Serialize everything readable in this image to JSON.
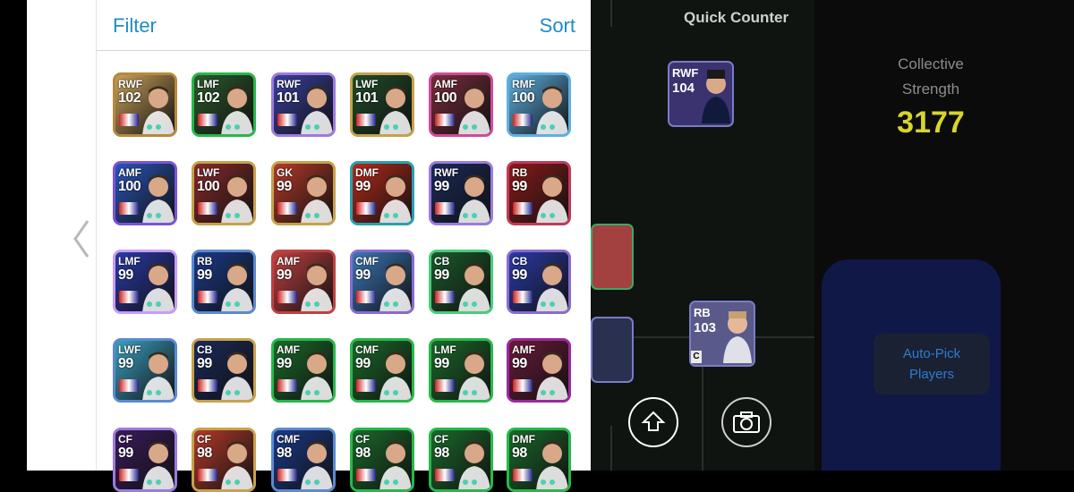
{
  "panel": {
    "filter_label": "Filter",
    "sort_label": "Sort"
  },
  "cards": [
    {
      "pos": "RWF",
      "ovr": "102",
      "bg": "#c9a05a",
      "border": "#b58a3c"
    },
    {
      "pos": "LMF",
      "ovr": "102",
      "bg": "#2c5a2c",
      "border": "#27b84b"
    },
    {
      "pos": "RWF",
      "ovr": "101",
      "bg": "#3a3f9e",
      "border": "#9b7be0"
    },
    {
      "pos": "LWF",
      "ovr": "101",
      "bg": "#1f4d2a",
      "border": "#c6a24b"
    },
    {
      "pos": "AMF",
      "ovr": "100",
      "bg": "#7a2c3c",
      "border": "#d04a9a"
    },
    {
      "pos": "RMF",
      "ovr": "100",
      "bg": "#5fb0e0",
      "border": "#5fb0e0"
    },
    {
      "pos": "AMF",
      "ovr": "100",
      "bg": "#2a55b8",
      "border": "#7b54d8"
    },
    {
      "pos": "LWF",
      "ovr": "100",
      "bg": "#8a2a2a",
      "border": "#c6a24b"
    },
    {
      "pos": "GK",
      "ovr": "99",
      "bg": "#b43a2a",
      "border": "#c6a24b"
    },
    {
      "pos": "DMF",
      "ovr": "99",
      "bg": "#b32a1a",
      "border": "#2aa0b0"
    },
    {
      "pos": "RWF",
      "ovr": "99",
      "bg": "#1a2a5a",
      "border": "#9b7be0"
    },
    {
      "pos": "RB",
      "ovr": "99",
      "bg": "#8a1a1a",
      "border": "#c13a5a"
    },
    {
      "pos": "LMF",
      "ovr": "99",
      "bg": "#2a3aa8",
      "border": "#c79cff"
    },
    {
      "pos": "RB",
      "ovr": "99",
      "bg": "#1a3a8a",
      "border": "#5b8ad0"
    },
    {
      "pos": "AMF",
      "ovr": "99",
      "bg": "#c04040",
      "border": "#c04040"
    },
    {
      "pos": "CMF",
      "ovr": "99",
      "bg": "#3a78b8",
      "border": "#8a6ad0"
    },
    {
      "pos": "CB",
      "ovr": "99",
      "bg": "#1a5a2a",
      "border": "#4acc7a"
    },
    {
      "pos": "CB",
      "ovr": "99",
      "bg": "#2a3aa8",
      "border": "#8a6ad0"
    },
    {
      "pos": "LWF",
      "ovr": "99",
      "bg": "#3aa0c0",
      "border": "#5b8ad0"
    },
    {
      "pos": "CB",
      "ovr": "99",
      "bg": "#1a2a5a",
      "border": "#c6a24b"
    },
    {
      "pos": "AMF",
      "ovr": "99",
      "bg": "#1a6a2a",
      "border": "#27b84b"
    },
    {
      "pos": "CMF",
      "ovr": "99",
      "bg": "#1a6a2a",
      "border": "#27b84b"
    },
    {
      "pos": "LMF",
      "ovr": "99",
      "bg": "#1a6a2a",
      "border": "#27b84b"
    },
    {
      "pos": "AMF",
      "ovr": "99",
      "bg": "#6a1a3a",
      "border": "#9b2a9a"
    },
    {
      "pos": "CF",
      "ovr": "99",
      "bg": "#3a1a5a",
      "border": "#9b7be0"
    },
    {
      "pos": "CF",
      "ovr": "98",
      "bg": "#b43a2a",
      "border": "#c6a24b"
    },
    {
      "pos": "CMF",
      "ovr": "98",
      "bg": "#1a3a8a",
      "border": "#5b8ad0"
    },
    {
      "pos": "CF",
      "ovr": "98",
      "bg": "#1a6a2a",
      "border": "#27b84b"
    },
    {
      "pos": "CF",
      "ovr": "98",
      "bg": "#1a6a2a",
      "border": "#27b84b"
    },
    {
      "pos": "DMF",
      "ovr": "98",
      "bg": "#1a6a2a",
      "border": "#27b84b"
    }
  ],
  "field": {
    "title": "Quick Counter",
    "players": [
      {
        "pos": "RWF",
        "ovr": "104"
      },
      {
        "pos": "RB",
        "ovr": "103"
      }
    ],
    "captain_badge": "C"
  },
  "side": {
    "collective_line1": "Collective",
    "collective_line2": "Strength",
    "collective_value": "3177",
    "autopick_line1": "Auto-Pick",
    "autopick_line2": "Players"
  },
  "colors": {
    "accent": "#1e8bc9",
    "strength": "#d8d52a",
    "autopick_text": "#2f7bd0"
  },
  "icons": {
    "back": "chevron-left-icon",
    "upload": "arrow-up-circle-icon",
    "camera": "camera-icon"
  }
}
